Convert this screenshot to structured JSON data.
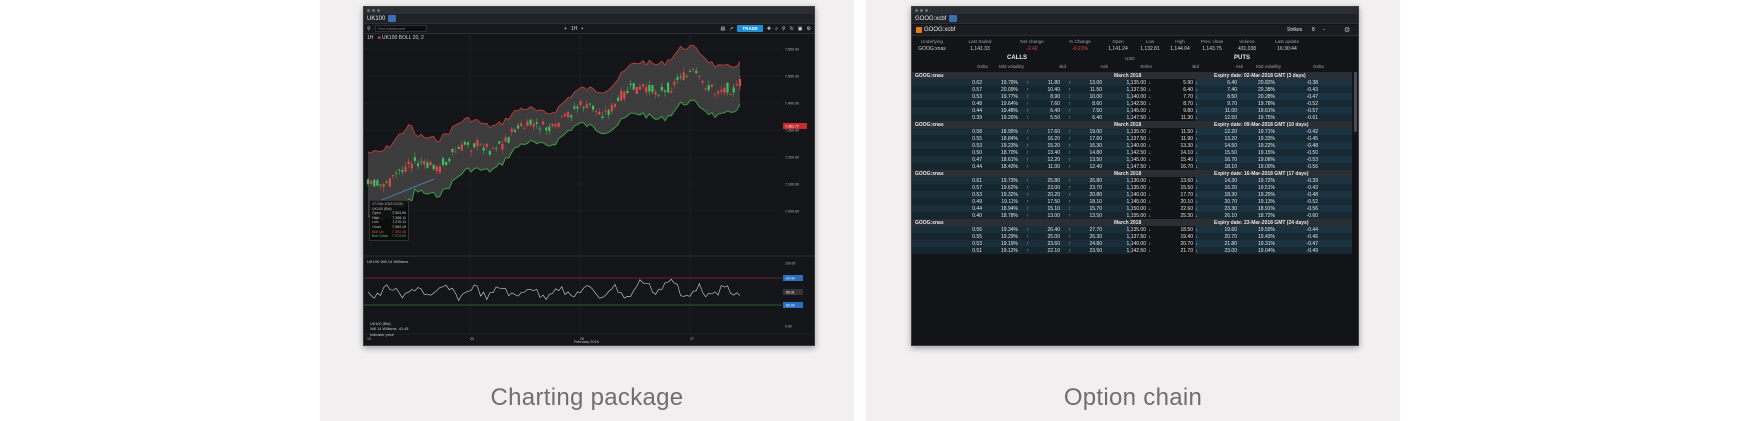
{
  "panels": {
    "left": {
      "caption": "Charting package"
    },
    "right": {
      "caption": "Option chain"
    }
  },
  "charting": {
    "tab": "UK100",
    "search_placeholder": "Find instrument",
    "trade_label": "TRADE",
    "timeframe": "1H",
    "instrument_label": "UK100 BOLL 20, 2",
    "ohlc": {
      "date": "17-Feb-2016 03:00",
      "instrument": "UK100 (Bid)",
      "rows": [
        {
          "k": "Open",
          "v": "7,303.00"
        },
        {
          "k": "High",
          "v": "7,306.11"
        },
        {
          "k": "Low",
          "v": "7,270.11"
        },
        {
          "k": "Close",
          "v": "7,304.19"
        },
        {
          "k": "Boll Up",
          "v": "7,393.46",
          "tone": "red"
        },
        {
          "k": "Boll Down",
          "v": "7,274.92",
          "tone": "green"
        }
      ]
    },
    "price_axis": [
      "7,600.00",
      "7,500.00",
      "7,400.00",
      "7,300.00",
      "7,200.00",
      "7,100.00",
      "7,000.00"
    ],
    "last_price_tag": "7,361.77",
    "osc_title": "UK100 Will 14 Williams",
    "osc_axis": [
      "100.00",
      "-20.00",
      "-50.00",
      "-80.00",
      "0.00"
    ],
    "osc_tags": [
      "-24.44",
      "-56.31",
      "-80.00"
    ],
    "osc_legend": [
      "UK100 (Bid)",
      "Will 14 Williams -41.45",
      "Indicator price"
    ],
    "x_labels": [
      "13",
      "20",
      "28",
      "27"
    ],
    "x_caption": "February 2016",
    "colors": {
      "bull": "#3fbf5a",
      "bear": "#e04646",
      "upper_band": "#c23a3a",
      "lower_band": "#3aa84a",
      "fill": "#4a4a4a"
    }
  },
  "option_chain": {
    "tab": "GOOG:xcbf",
    "title": "GOOG:xcbf",
    "strikes_label": "Strikes",
    "strikes_value": "8",
    "summary_keys": [
      "Underlying",
      "Last traded",
      "Net change",
      "% Change",
      "Open",
      "Low",
      "High",
      "Prev. close",
      "Volume",
      "Last update"
    ],
    "summary_values": [
      "GOOG:xnas",
      "1,141.33",
      "-2.42",
      "-0.21%",
      "1,141.24",
      "1,132.81",
      "1,144.04",
      "1,143.75",
      "431,038",
      "16:30:44"
    ],
    "calls_label": "CALLS",
    "currency": "USD",
    "puts_label": "PUTS",
    "col_heads": [
      "Delta",
      "Mid volatility",
      "Bid",
      "Ask",
      "Strike",
      "Bid",
      "Ask",
      "Mid volatility",
      "Delta"
    ],
    "groups": [
      {
        "underlying": "GOOG:xnas",
        "month": "March 2018",
        "expiry": "Expiry date: 02-Mar-2018 GMT (3 days)",
        "rows": [
          [
            "0.62",
            "19.79%",
            "11.80",
            "13.00",
            "1,135.00",
            "5.90",
            "6.40",
            "20.82%",
            "-0.38"
          ],
          [
            "0.57",
            "20.09%",
            "10.40",
            "11.50",
            "1,137.50",
            "6.40",
            "7.40",
            "20.38%",
            "-0.43"
          ],
          [
            "0.53",
            "19.77%",
            "8.90",
            "10.00",
            "1,140.00",
            "7.70",
            "8.50",
            "20.28%",
            "-0.47"
          ],
          [
            "0.48",
            "19.64%",
            "7.60",
            "8.60",
            "1,142.50",
            "8.70",
            "9.70",
            "19.78%",
            "-0.52"
          ],
          [
            "0.44",
            "19.48%",
            "6.40",
            "7.50",
            "1,145.00",
            "9.80",
            "11.00",
            "19.61%",
            "-0.57"
          ],
          [
            "0.39",
            "19.26%",
            "5.50",
            "6.40",
            "1,147.50",
            "11.30",
            "12.50",
            "19.75%",
            "-0.61"
          ]
        ]
      },
      {
        "underlying": "GOOG:xnas",
        "month": "March 2018",
        "expiry": "Expiry date: 09-Mar-2018 GMT (10 days)",
        "rows": [
          [
            "0.58",
            "18.95%",
            "17.60",
            "19.00",
            "1,135.00",
            "11.50",
            "12.20",
            "19.71%",
            "-0.42"
          ],
          [
            "0.55",
            "18.84%",
            "16.20",
            "17.60",
            "1,137.50",
            "11.90",
            "13.20",
            "19.33%",
            "-0.45"
          ],
          [
            "0.53",
            "19.23%",
            "15.20",
            "16.30",
            "1,140.00",
            "13.30",
            "14.50",
            "19.22%",
            "-0.48"
          ],
          [
            "0.50",
            "18.70%",
            "13.40",
            "14.80",
            "1,142.50",
            "14.10",
            "15.50",
            "19.15%",
            "-0.50"
          ],
          [
            "0.47",
            "18.61%",
            "12.20",
            "13.50",
            "1,145.00",
            "15.40",
            "16.70",
            "19.06%",
            "-0.53"
          ],
          [
            "0.44",
            "18.43%",
            "11.00",
            "12.40",
            "1,147.50",
            "16.70",
            "18.10",
            "19.00%",
            "-0.56"
          ]
        ]
      },
      {
        "underlying": "GOOG:xnas",
        "month": "March 2018",
        "expiry": "Expiry date: 16-Mar-2018 GMT (17 days)",
        "rows": [
          [
            "0.61",
            "19.73%",
            "25.80",
            "26.80",
            "1,130.00",
            "13.60",
            "14.30",
            "19.72%",
            "-0.39"
          ],
          [
            "0.57",
            "19.62%",
            "23.00",
            "23.70",
            "1,135.00",
            "15.50",
            "16.20",
            "19.51%",
            "-0.43"
          ],
          [
            "0.53",
            "19.32%",
            "20.20",
            "20.80",
            "1,140.00",
            "17.70",
            "18.30",
            "19.25%",
            "-0.48"
          ],
          [
            "0.49",
            "19.11%",
            "17.50",
            "18.10",
            "1,145.00",
            "20.10",
            "20.70",
            "19.13%",
            "-0.52"
          ],
          [
            "0.44",
            "18.94%",
            "15.10",
            "15.70",
            "1,150.00",
            "22.60",
            "23.30",
            "18.91%",
            "-0.56"
          ],
          [
            "0.40",
            "18.78%",
            "13.00",
            "13.50",
            "1,155.00",
            "25.30",
            "26.10",
            "18.72%",
            "-0.60"
          ]
        ]
      },
      {
        "underlying": "GOOG:xnas",
        "month": "March 2018",
        "expiry": "Expiry date: 23-Mar-2018 GMT (24 days)",
        "rows": [
          [
            "0.56",
            "19.34%",
            "26.40",
            "27.70",
            "1,135.00",
            "18.50",
            "19.60",
            "19.50%",
            "-0.44"
          ],
          [
            "0.55",
            "19.29%",
            "25.00",
            "26.30",
            "1,137.50",
            "19.40",
            "20.70",
            "19.43%",
            "-0.46"
          ],
          [
            "0.53",
            "19.19%",
            "23.60",
            "24.80",
            "1,140.00",
            "20.70",
            "21.80",
            "19.31%",
            "-0.47"
          ],
          [
            "0.51",
            "19.12%",
            "22.10",
            "23.50",
            "1,142.50",
            "21.70",
            "23.00",
            "19.04%",
            "-0.49"
          ]
        ]
      }
    ]
  }
}
